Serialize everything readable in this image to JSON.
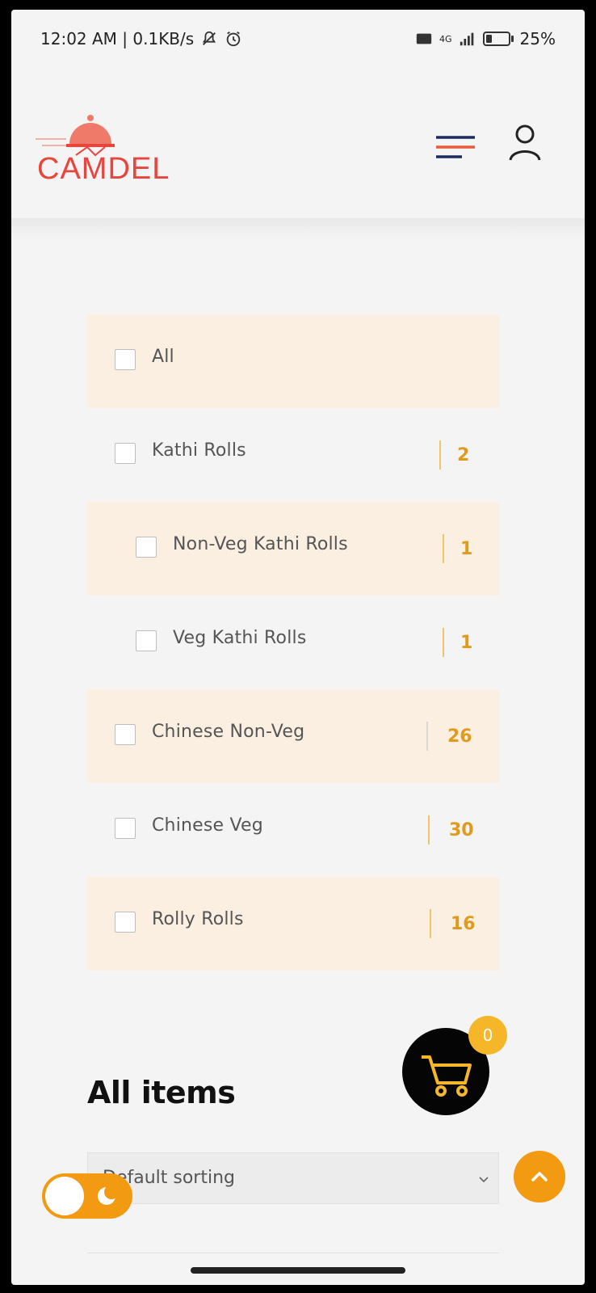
{
  "status_bar": {
    "time_speed": "12:02 AM | 0.1KB/s",
    "network": "4G",
    "battery": "25%"
  },
  "header": {
    "logo_text": "CAMDEL",
    "menu_icon": "hamburger-menu-icon",
    "user_icon": "user-account-icon"
  },
  "categories": [
    {
      "label": "All",
      "count": ""
    },
    {
      "label": "Kathi Rolls",
      "count": "2"
    },
    {
      "label": "Non-Veg Kathi Rolls",
      "count": "1"
    },
    {
      "label": "Veg Kathi Rolls",
      "count": "1"
    },
    {
      "label": "Chinese Non-Veg",
      "count": "26"
    },
    {
      "label": "Chinese Veg",
      "count": "30"
    },
    {
      "label": "Rolly Rolls",
      "count": "16"
    }
  ],
  "cart": {
    "count": "0",
    "icon": "shopping-cart-icon"
  },
  "main": {
    "section_title": "All items",
    "sort_value": "Default sorting"
  },
  "colors": {
    "accent": "#f29a12",
    "row_shade": "#fbefe2",
    "count_text": "#e09a1c",
    "logo_red": "#e8453c"
  }
}
